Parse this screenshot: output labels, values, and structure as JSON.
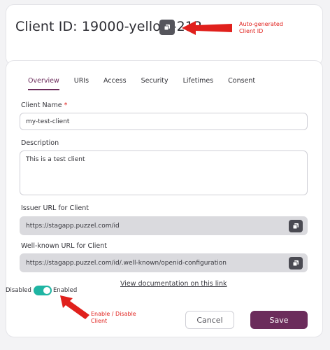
{
  "header": {
    "client_id_label": "Client ID: 19000-yellow-212",
    "annotation": [
      "Auto-generated",
      "Client ID"
    ]
  },
  "tabs": [
    {
      "label": "Overview",
      "active": true
    },
    {
      "label": "URIs",
      "active": false
    },
    {
      "label": "Access",
      "active": false
    },
    {
      "label": "Security",
      "active": false
    },
    {
      "label": "Lifetimes",
      "active": false
    },
    {
      "label": "Consent",
      "active": false
    }
  ],
  "form": {
    "client_name_label": "Client Name",
    "client_name_required": "*",
    "client_name_value": "my-test-client",
    "description_label": "Description",
    "description_value": "This is a test client",
    "issuer_label": "Issuer URL for Client",
    "issuer_value": "https://stagapp.puzzel.com/id",
    "wellknown_label": "Well-known URL for Client",
    "wellknown_value": "https://stagapp.puzzel.com/id/.well-known/openid-configuration",
    "doc_link": "View documentation on this link"
  },
  "toggle": {
    "disabled_label": "Disabled",
    "enabled_label": "Enabled",
    "state": "enabled",
    "annotation": [
      "Enable / Disable",
      "Client"
    ]
  },
  "actions": {
    "cancel_label": "Cancel",
    "save_label": "Save"
  },
  "colors": {
    "accent": "#6b2c5b",
    "toggle_on": "#1fb5a3",
    "annotation": "#e0201c"
  }
}
